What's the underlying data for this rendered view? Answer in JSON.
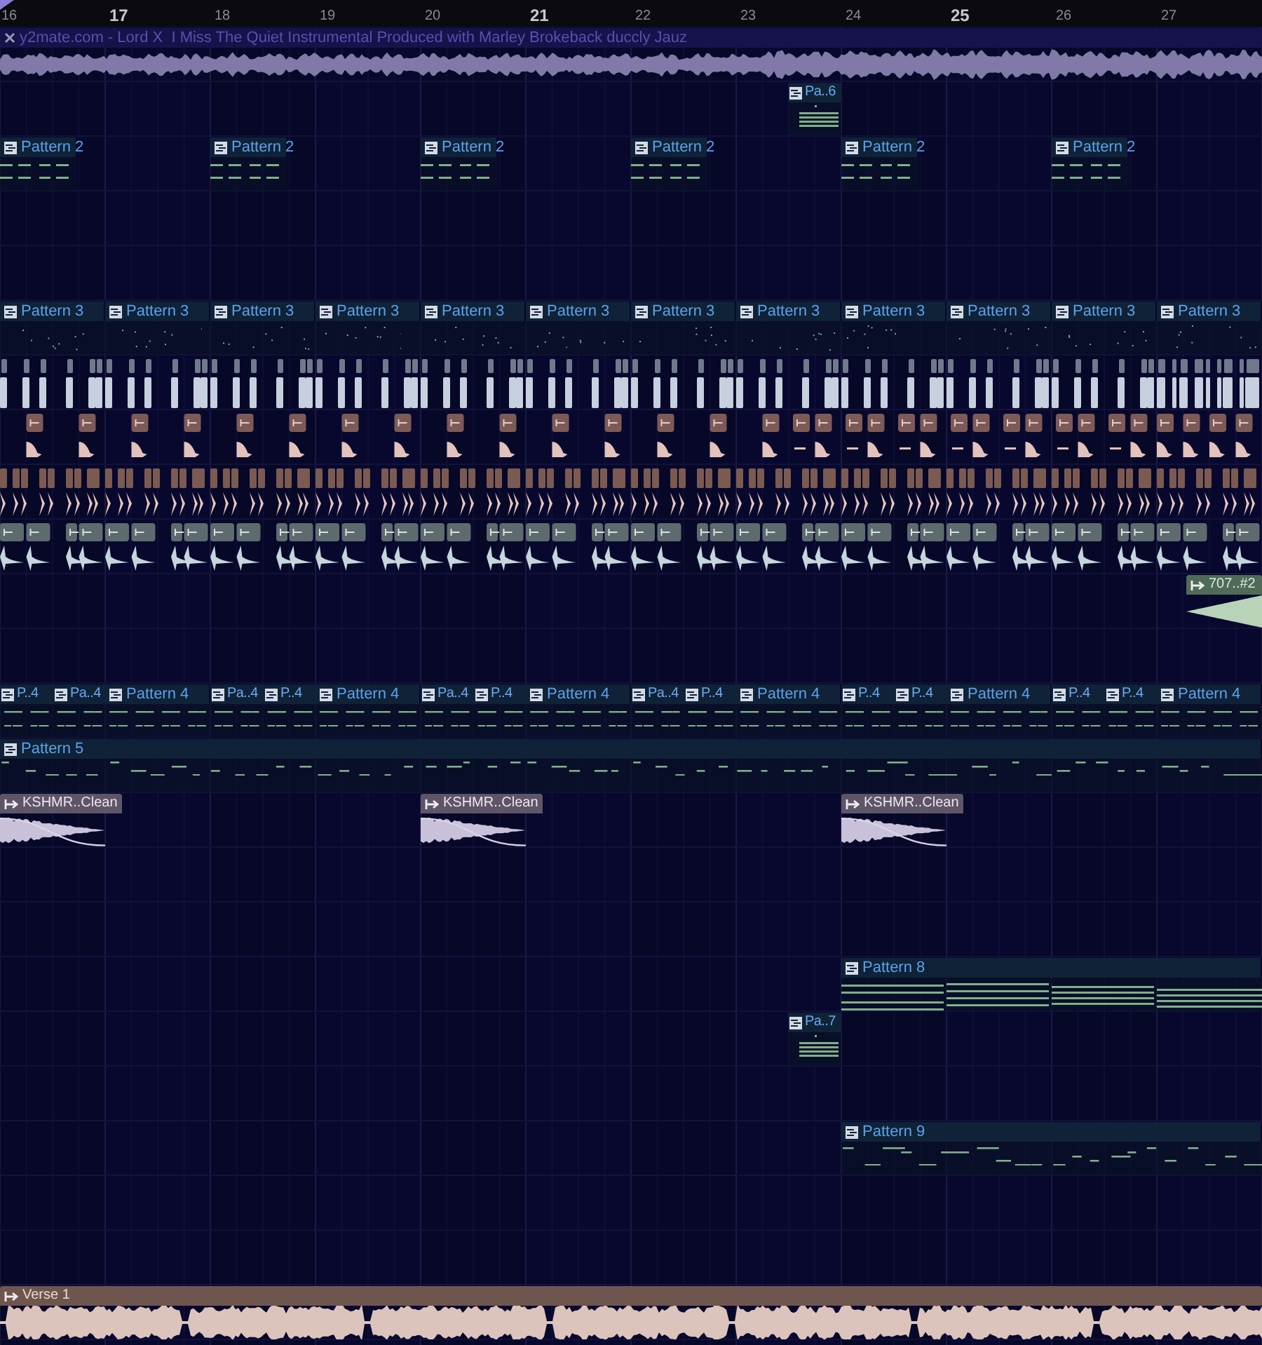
{
  "ruler": {
    "bars": [
      "16",
      "17",
      "18",
      "19",
      "20",
      "21",
      "22",
      "23",
      "24",
      "25",
      "26",
      "27"
    ]
  },
  "tracks": [
    {
      "kind": "audio",
      "clips": [
        {
          "label": "y2mate.com - Lord X  I Miss The Quiet Instrumental Produced with Marley Brokeback duccly Jauz"
        }
      ]
    },
    {
      "kind": "pattern",
      "clips": [
        {
          "label": "Pa..6"
        }
      ]
    },
    {
      "kind": "pattern",
      "clips": [
        {
          "label": "Pattern 2"
        },
        {
          "label": "Pattern 2"
        },
        {
          "label": "Pattern 2"
        },
        {
          "label": "Pattern 2"
        },
        {
          "label": "Pattern 2"
        },
        {
          "label": "Pattern 2"
        }
      ]
    },
    {
      "kind": "pattern",
      "clips": [
        {
          "label": "Pattern 3"
        },
        {
          "label": "Pattern 3"
        },
        {
          "label": "Pattern 3"
        },
        {
          "label": "Pattern 3"
        },
        {
          "label": "Pattern 3"
        },
        {
          "label": "Pattern 3"
        },
        {
          "label": "Pattern 3"
        },
        {
          "label": "Pattern 3"
        },
        {
          "label": "Pattern 3"
        },
        {
          "label": "Pattern 3"
        },
        {
          "label": "Pattern 3"
        },
        {
          "label": "Pattern 3"
        }
      ]
    },
    {
      "kind": "hats"
    },
    {
      "kind": "claps"
    },
    {
      "kind": "snares"
    },
    {
      "kind": "kicks"
    },
    {
      "kind": "sample",
      "clips": [
        {
          "label": "707..#2"
        }
      ]
    },
    {
      "kind": "pattern",
      "clips": [
        {
          "label": "P..4"
        },
        {
          "label": "Pa..4"
        },
        {
          "label": "Pattern 4"
        },
        {
          "label": "Pa..4"
        },
        {
          "label": "P..4"
        },
        {
          "label": "Pattern 4"
        },
        {
          "label": "Pa..4"
        },
        {
          "label": "P..4"
        },
        {
          "label": "Pattern 4"
        },
        {
          "label": "Pa..4"
        },
        {
          "label": "P..4"
        },
        {
          "label": "Pattern 4"
        },
        {
          "label": "P..4"
        },
        {
          "label": "P..4"
        },
        {
          "label": "Pattern 4"
        },
        {
          "label": "P..4"
        },
        {
          "label": "P..4"
        },
        {
          "label": "Pattern 4"
        }
      ]
    },
    {
      "kind": "pattern",
      "clips": [
        {
          "label": "Pattern 5"
        }
      ]
    },
    {
      "kind": "sample",
      "clips": [
        {
          "label": "KSHMR..Clean"
        },
        {
          "label": "KSHMR..Clean"
        },
        {
          "label": "KSHMR..Clean"
        }
      ]
    },
    {
      "kind": "pattern",
      "clips": [
        {
          "label": "Pattern 8"
        }
      ]
    },
    {
      "kind": "pattern",
      "clips": [
        {
          "label": "Pa..7"
        }
      ]
    },
    {
      "kind": "pattern",
      "clips": [
        {
          "label": "Pattern 9"
        }
      ]
    },
    {
      "kind": "sample",
      "clips": [
        {
          "label": "Verse 1"
        }
      ]
    }
  ]
}
